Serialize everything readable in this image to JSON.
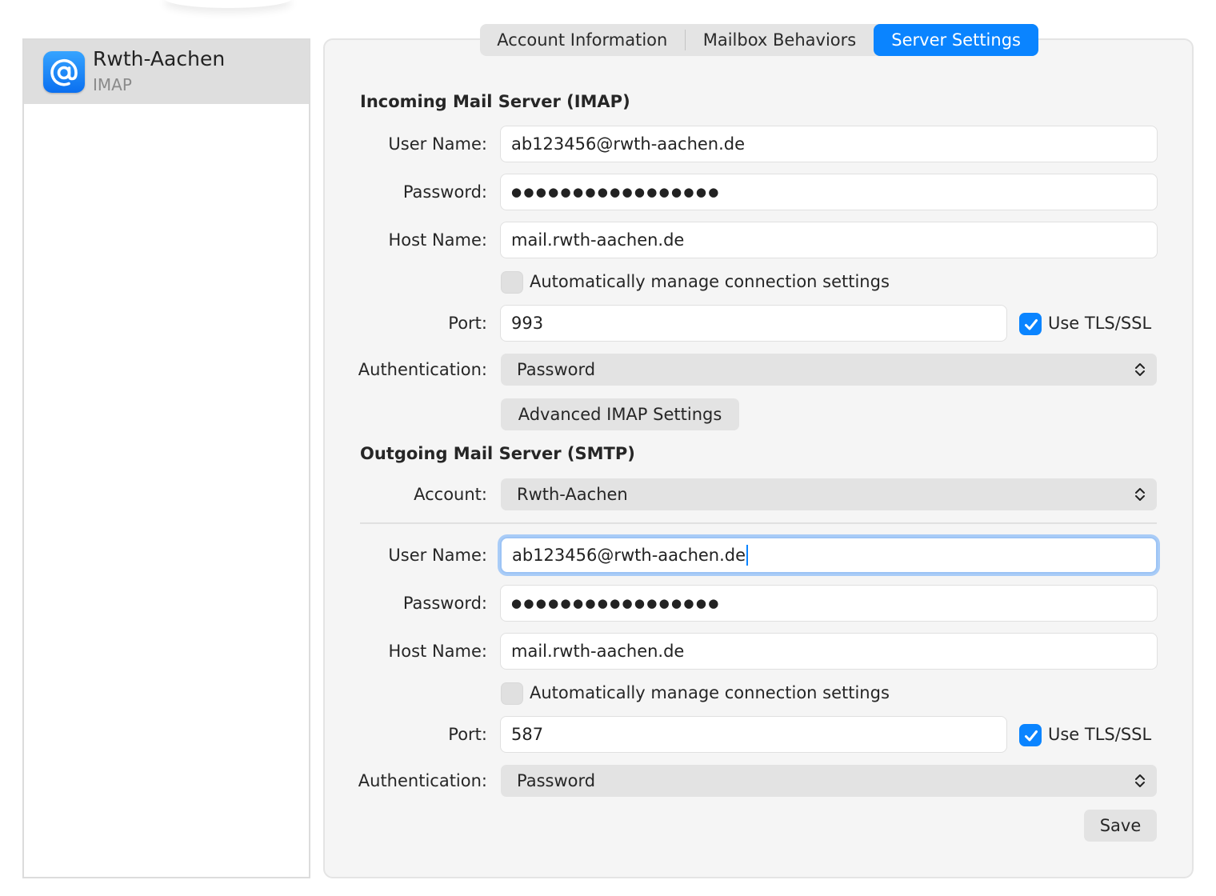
{
  "sidebar": {
    "account": {
      "name": "Rwth-Aachen",
      "type": "IMAP",
      "icon": "at-sign-icon"
    }
  },
  "tabs": [
    {
      "label": "Account Information",
      "selected": false
    },
    {
      "label": "Mailbox Behaviors",
      "selected": false
    },
    {
      "label": "Server Settings",
      "selected": true
    }
  ],
  "incoming": {
    "title": "Incoming Mail Server (IMAP)",
    "username_label": "User Name:",
    "username": "ab123456@rwth-aachen.de",
    "password_label": "Password:",
    "password_mask": "●●●●●●●●●●●●●●●●●",
    "host_label": "Host Name:",
    "host": "mail.rwth-aachen.de",
    "auto_manage_label": "Automatically manage connection settings",
    "auto_manage_checked": false,
    "port_label": "Port:",
    "port": "993",
    "tls_label": "Use TLS/SSL",
    "tls_checked": true,
    "auth_label": "Authentication:",
    "auth_value": "Password",
    "advanced_button": "Advanced IMAP Settings"
  },
  "outgoing": {
    "title": "Outgoing Mail Server (SMTP)",
    "account_label": "Account:",
    "account_value": "Rwth-Aachen",
    "username_label": "User Name:",
    "username": "ab123456@rwth-aachen.de",
    "password_label": "Password:",
    "password_mask": "●●●●●●●●●●●●●●●●●",
    "host_label": "Host Name:",
    "host": "mail.rwth-aachen.de",
    "auto_manage_label": "Automatically manage connection settings",
    "auto_manage_checked": false,
    "port_label": "Port:",
    "port": "587",
    "tls_label": "Use TLS/SSL",
    "tls_checked": true,
    "auth_label": "Authentication:",
    "auth_value": "Password"
  },
  "save_label": "Save",
  "colors": {
    "accent": "#0a84ff",
    "focus_ring": "#a9ccf7"
  }
}
